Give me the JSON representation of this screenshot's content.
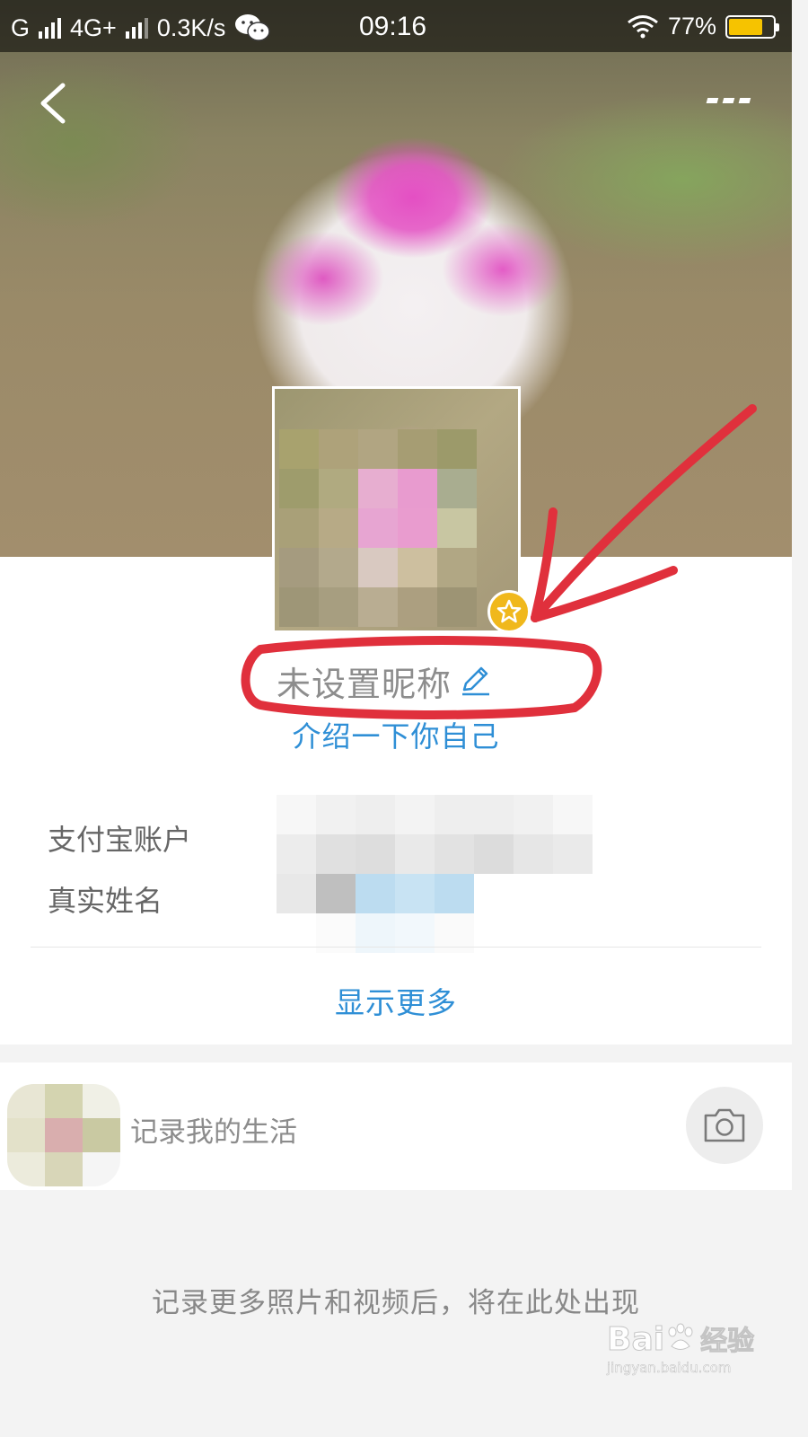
{
  "status_bar": {
    "carrier_1": "G",
    "carrier_2": "4G+",
    "net_speed": "0.3K/s",
    "time": "09:16",
    "battery_percent": "77%",
    "battery_level": 0.77,
    "icons": [
      "signal-icon",
      "wechat-icon",
      "wifi-icon",
      "battery-icon"
    ]
  },
  "header": {
    "back_icon": "chevron-left-icon",
    "more_icon": "more-dots-icon"
  },
  "profile": {
    "nickname": "未设置昵称",
    "edit_icon": "pencil-icon",
    "intro_prompt": "介绍一下你自己",
    "badge_icon": "star-icon"
  },
  "account_info": {
    "alipay_label": "支付宝账户",
    "real_name_label": "真实姓名",
    "show_more": "显示更多"
  },
  "record": {
    "prompt": "记录我的生活",
    "camera_icon": "camera-icon",
    "empty_hint": "记录更多照片和视频后，将在此处出现"
  },
  "watermark": {
    "brand": "Bai",
    "brand_cn": "经验",
    "url": "jingyan.baidu.com"
  },
  "colors": {
    "accent_blue": "#2f8fd6",
    "badge_gold": "#f0b81c",
    "annotation_red": "#e0303c"
  }
}
